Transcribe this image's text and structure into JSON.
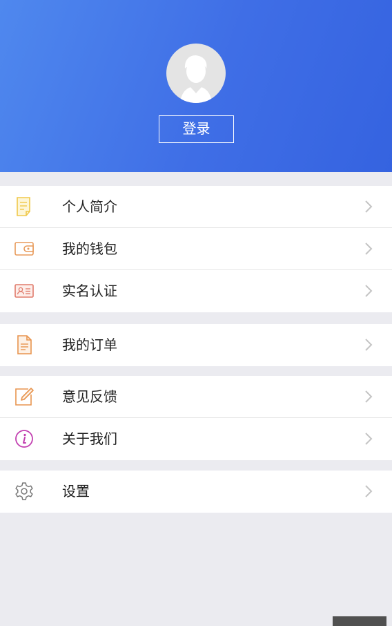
{
  "header": {
    "login_label": "登录",
    "gradient_start": "#4f88ee",
    "gradient_end": "#3563e0"
  },
  "menu": {
    "groups": [
      {
        "items": [
          {
            "label": "个人简介",
            "icon": "document-icon",
            "icon_color": "#f0c84a"
          },
          {
            "label": "我的钱包",
            "icon": "wallet-icon",
            "icon_color": "#e89a5a"
          },
          {
            "label": "实名认证",
            "icon": "id-card-icon",
            "icon_color": "#e07a6a"
          }
        ]
      },
      {
        "items": [
          {
            "label": "我的订单",
            "icon": "order-icon",
            "icon_color": "#e8944e"
          }
        ]
      },
      {
        "items": [
          {
            "label": "意见反馈",
            "icon": "feedback-edit-icon",
            "icon_color": "#e8944e"
          },
          {
            "label": "关于我们",
            "icon": "info-icon",
            "icon_color": "#c23fb0"
          }
        ]
      },
      {
        "items": [
          {
            "label": "设置",
            "icon": "gear-icon",
            "icon_color": "#777777"
          }
        ]
      }
    ]
  }
}
